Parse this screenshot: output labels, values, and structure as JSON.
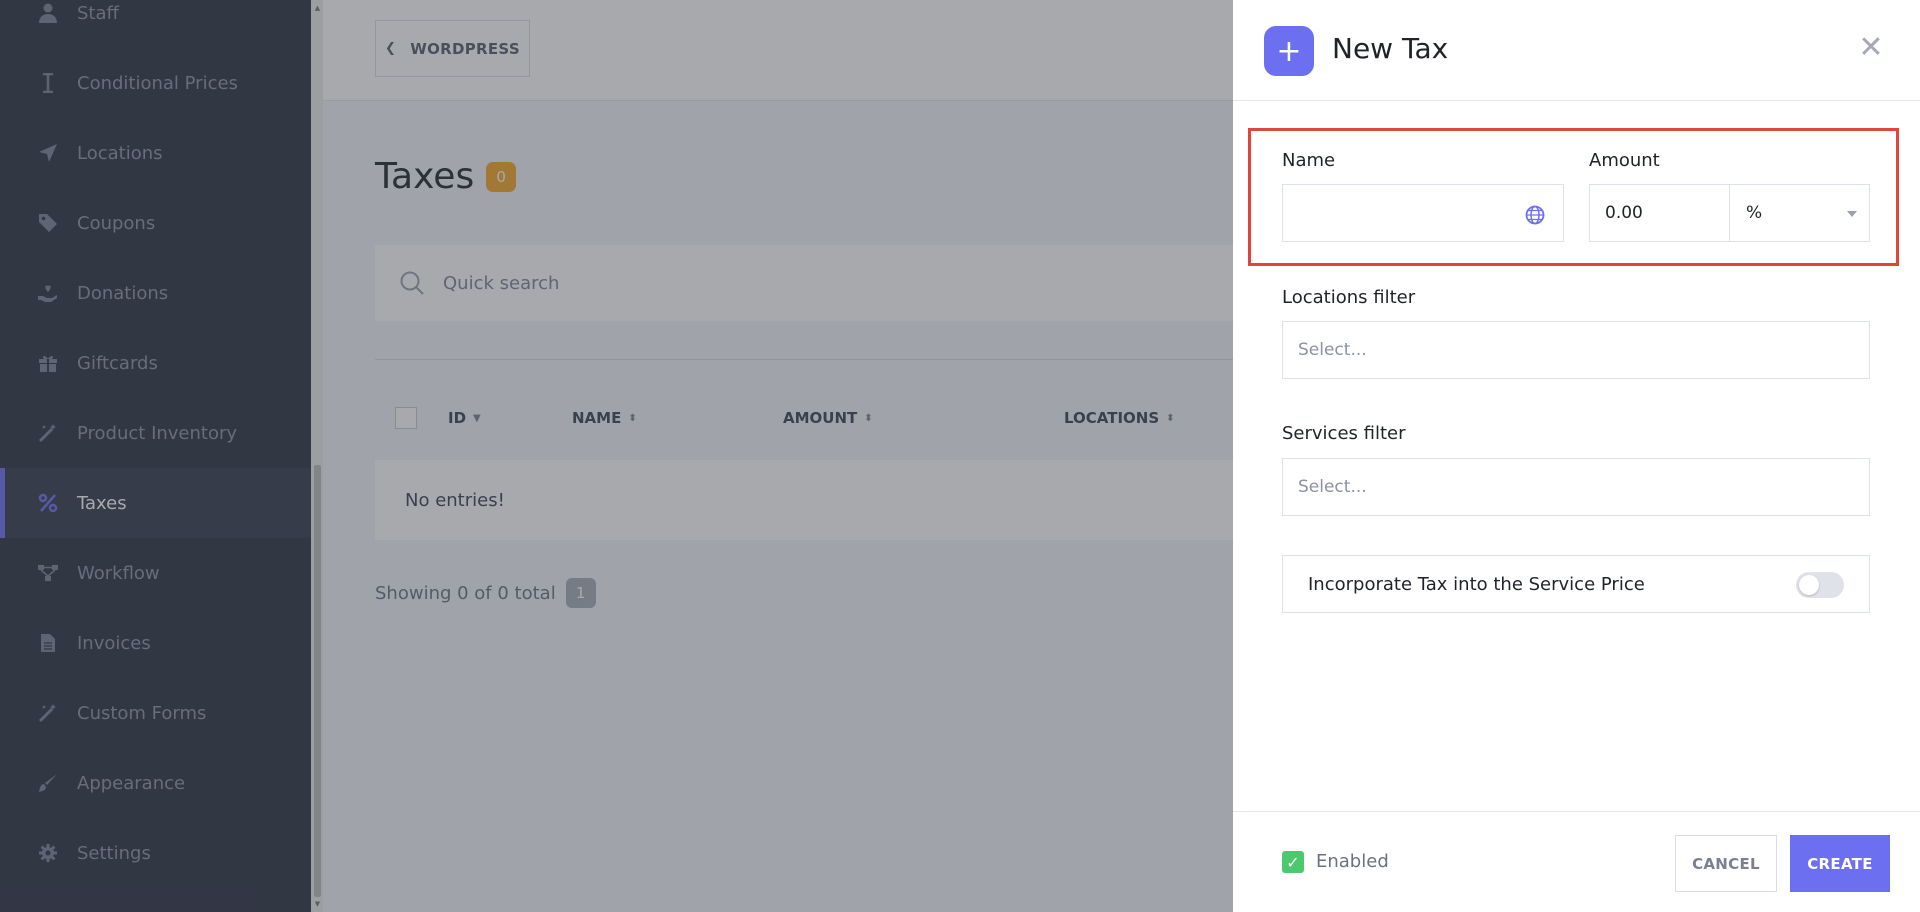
{
  "sidebar": {
    "items": [
      {
        "label": "Staff",
        "icon": "user-icon"
      },
      {
        "label": "Conditional Prices",
        "icon": "cursor-text-icon"
      },
      {
        "label": "Locations",
        "icon": "location-arrow-icon"
      },
      {
        "label": "Coupons",
        "icon": "tag-icon"
      },
      {
        "label": "Donations",
        "icon": "hand-heart-icon"
      },
      {
        "label": "Giftcards",
        "icon": "gift-icon"
      },
      {
        "label": "Product Inventory",
        "icon": "magic-wand-icon"
      },
      {
        "label": "Taxes",
        "icon": "percent-icon"
      },
      {
        "label": "Workflow",
        "icon": "workflow-icon"
      },
      {
        "label": "Invoices",
        "icon": "document-icon"
      },
      {
        "label": "Custom Forms",
        "icon": "magic-wand-icon"
      },
      {
        "label": "Appearance",
        "icon": "brush-icon"
      },
      {
        "label": "Settings",
        "icon": "gear-icon"
      }
    ],
    "active": "Taxes"
  },
  "topbar": {
    "wordpress_label": "WORDPRESS"
  },
  "page": {
    "title": "Taxes",
    "count": "0",
    "search_placeholder": "Quick search",
    "columns": [
      "ID",
      "NAME",
      "AMOUNT",
      "LOCATIONS"
    ],
    "empty_text": "No entries!",
    "showing_text": "Showing 0 of 0 total",
    "page_number": "1"
  },
  "modal": {
    "title": "New Tax",
    "name_label": "Name",
    "name_value": "",
    "amount_label": "Amount",
    "amount_value": "0.00",
    "amount_unit": "%",
    "locations_label": "Locations filter",
    "locations_placeholder": "Select...",
    "services_label": "Services filter",
    "services_placeholder": "Select...",
    "incorporate_label": "Incorporate Tax into the Service Price",
    "incorporate_on": false,
    "enabled_label": "Enabled",
    "enabled_checked": true,
    "cancel_label": "CANCEL",
    "create_label": "CREATE"
  },
  "colors": {
    "accent": "#6c6ff0",
    "sidebar_bg": "#2b3040",
    "highlight": "#e0453a",
    "count_badge": "#f5a623",
    "enabled_check": "#4cc96f"
  }
}
